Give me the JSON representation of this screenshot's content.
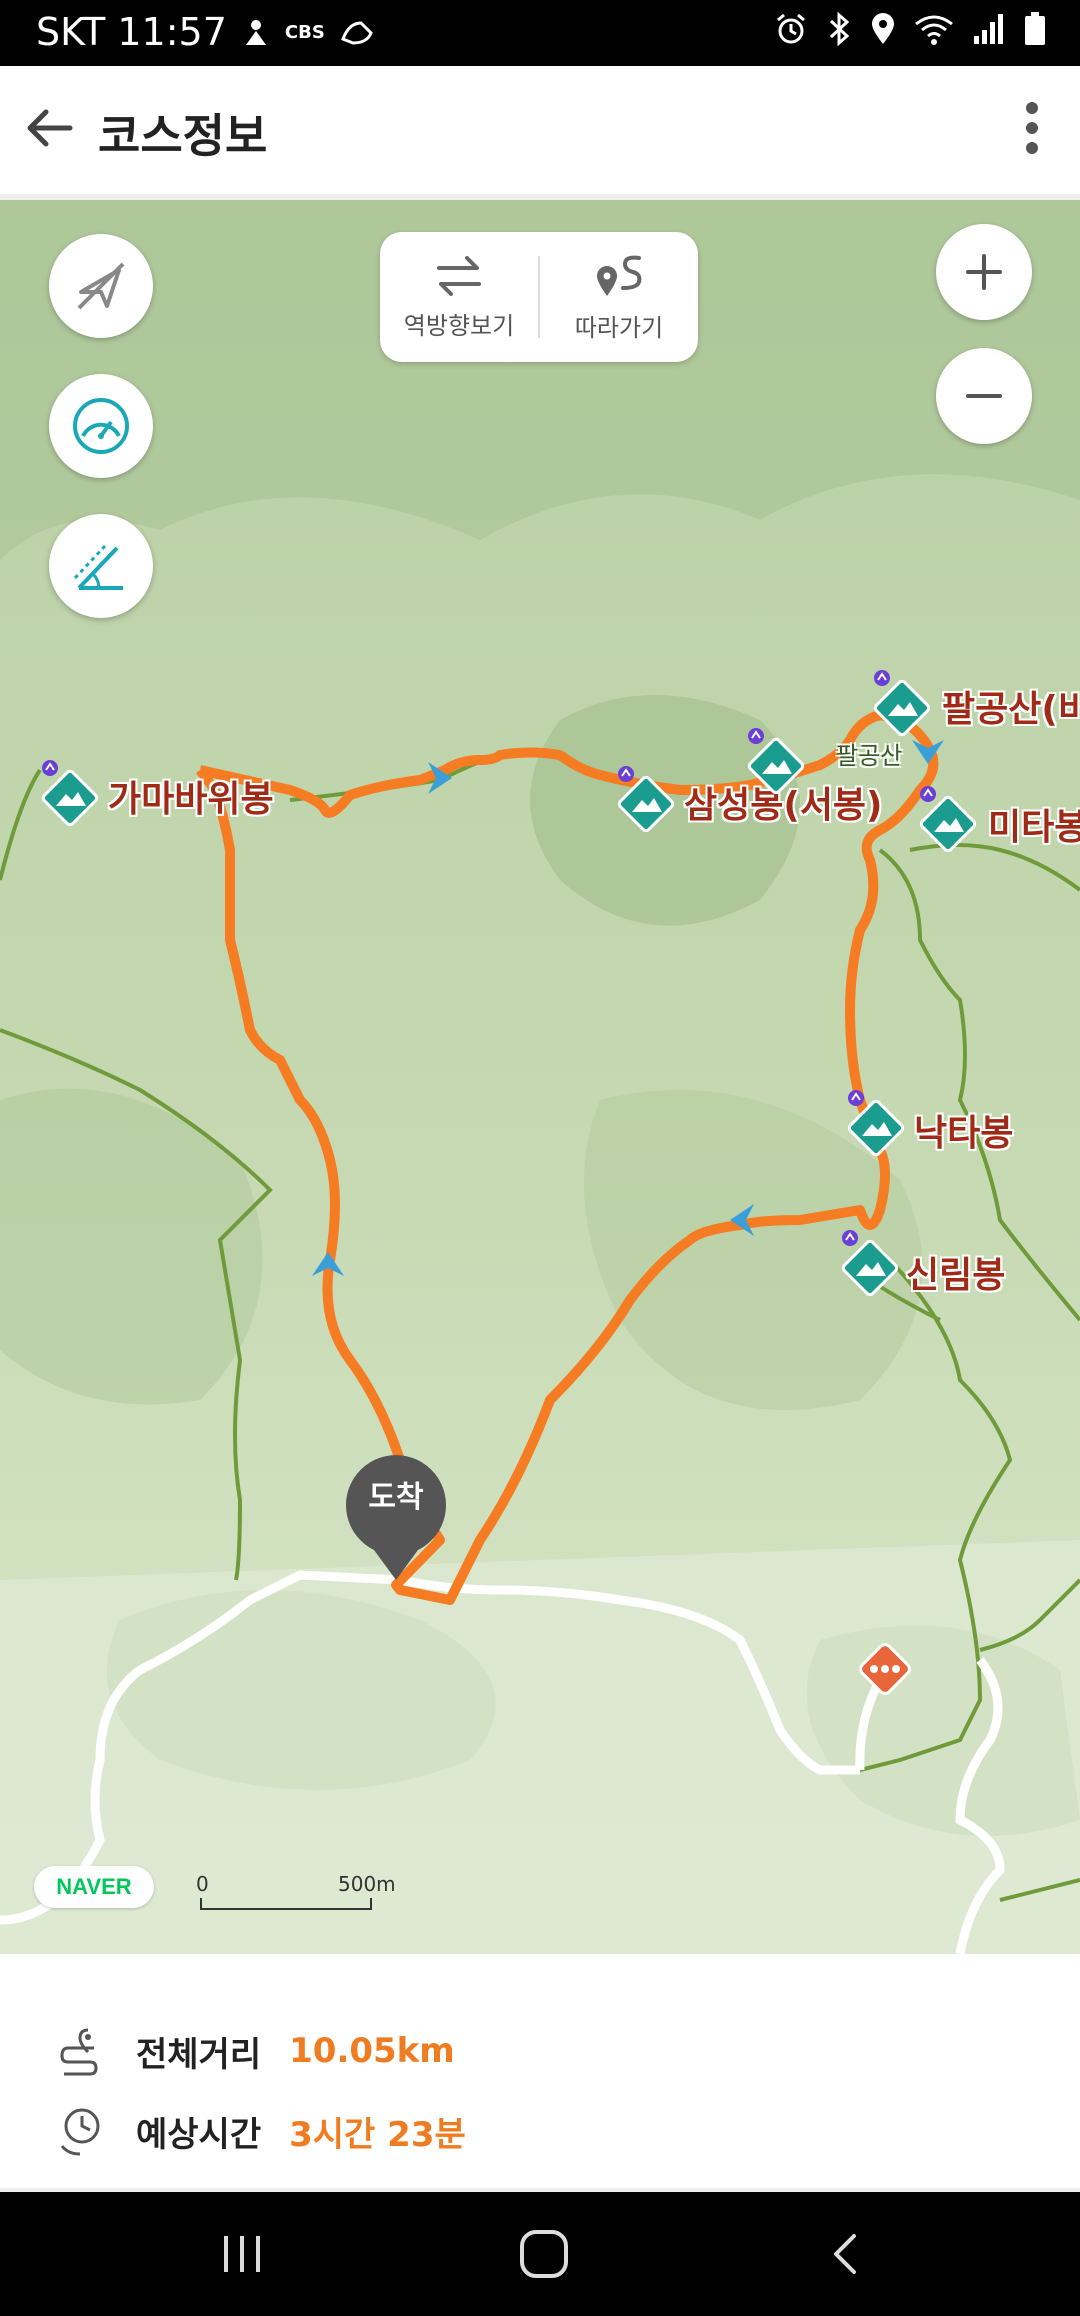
{
  "status_bar": {
    "carrier_time": "SKT 11:57",
    "small_icon_text": "CBS",
    "icons": [
      "alarm-icon",
      "bluetooth-icon",
      "location-icon",
      "wifi-icon",
      "signal-icon",
      "battery-icon"
    ]
  },
  "app_bar": {
    "title": "코스정보"
  },
  "map": {
    "controls": {
      "reverse_label": "역방향보기",
      "follow_label": "따라가기"
    },
    "peaks": [
      {
        "name": "가마바위봉"
      },
      {
        "name": "삼성봉(서봉)"
      },
      {
        "name": "팔공산(비"
      },
      {
        "name": "미타봉"
      },
      {
        "name": "낙타봉"
      },
      {
        "name": "신림봉"
      }
    ],
    "area_label": "팔공산",
    "arrival_label": "도착",
    "logo": "NAVER",
    "scale": {
      "zero": "0",
      "distance": "500m"
    },
    "colors": {
      "route": "#f57c22",
      "trail": "#6f9b3a",
      "peak_icon": "#1a9c8e",
      "peak_text": "#a12a17"
    }
  },
  "course_info": {
    "total_distance_label": "전체거리",
    "total_distance_value": "10.05km",
    "estimated_time_label": "예상시간",
    "estimated_time_value": "3시간 23분"
  }
}
